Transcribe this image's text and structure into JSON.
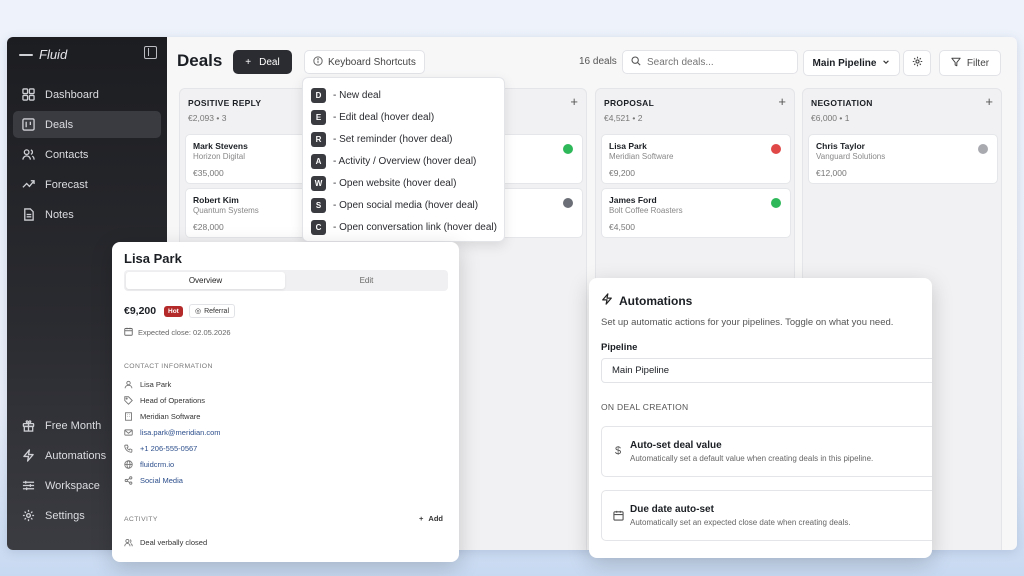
{
  "brand": {
    "name": "Fluid"
  },
  "sidebar": {
    "items": [
      {
        "label": "Dashboard",
        "icon": "grid-icon",
        "active": false
      },
      {
        "label": "Deals",
        "icon": "kanban-icon",
        "active": true
      },
      {
        "label": "Contacts",
        "icon": "users-icon",
        "active": false
      },
      {
        "label": "Forecast",
        "icon": "trend-icon",
        "active": false
      },
      {
        "label": "Notes",
        "icon": "note-icon",
        "active": false
      }
    ],
    "bottom_items": [
      {
        "label": "Free Month",
        "icon": "gift-icon"
      },
      {
        "label": "Automations",
        "icon": "bolt-icon"
      },
      {
        "label": "Workspace",
        "icon": "sliders-icon"
      },
      {
        "label": "Settings",
        "icon": "gear-icon"
      }
    ]
  },
  "header": {
    "title": "Deals",
    "new_deal_label": "Deal",
    "shortcuts_label": "Keyboard Shortcuts",
    "deal_count": "16 deals",
    "search_placeholder": "Search deals...",
    "pipeline": "Main Pipeline",
    "filter_label": "Filter"
  },
  "columns": [
    {
      "title": "POSITIVE REPLY",
      "meta": "€2,093 • 3",
      "cards": [
        {
          "name": "Mark Stevens",
          "company": "Horizon Digital",
          "value": "€35,000",
          "status_color": ""
        },
        {
          "name": "Robert Kim",
          "company": "Quantum Systems",
          "value": "€28,000",
          "status_color": ""
        }
      ]
    },
    {
      "title": "",
      "meta": "",
      "cards": [
        {
          "name": "",
          "company": "",
          "value": "",
          "status_color": "#2fb85a"
        },
        {
          "name": "",
          "company": "",
          "value": "",
          "status_color": "#6b6e76"
        }
      ]
    },
    {
      "title": "PROPOSAL",
      "meta": "€4,521 • 2",
      "cards": [
        {
          "name": "Lisa Park",
          "company": "Meridian Software",
          "value": "€9,200",
          "status_color": "#e04848"
        },
        {
          "name": "James Ford",
          "company": "Bolt Coffee Roasters",
          "value": "€4,500",
          "status_color": "#2fb85a"
        }
      ]
    },
    {
      "title": "NEGOTIATION",
      "meta": "€6,000 • 1",
      "cards": [
        {
          "name": "Chris Taylor",
          "company": "Vanguard Solutions",
          "value": "€12,000",
          "status_color": "#a8aab0"
        }
      ]
    }
  ],
  "shortcuts": [
    {
      "key": "D",
      "label": "- New deal"
    },
    {
      "key": "E",
      "label": "- Edit deal (hover deal)"
    },
    {
      "key": "R",
      "label": "- Set reminder (hover deal)"
    },
    {
      "key": "A",
      "label": "- Activity / Overview (hover deal)"
    },
    {
      "key": "W",
      "label": "- Open website (hover deal)"
    },
    {
      "key": "S",
      "label": "- Open social media (hover deal)"
    },
    {
      "key": "C",
      "label": "- Open conversation link (hover deal)"
    }
  ],
  "detail": {
    "name": "Lisa Park",
    "tabs": [
      "Overview",
      "Edit"
    ],
    "value": "€9,200",
    "hot_badge": "Hot",
    "referral_badge": "Referral",
    "expected_close": "Expected close: 02.05.2026",
    "contact_section": "CONTACT INFORMATION",
    "contact": [
      {
        "icon": "user-icon",
        "text": "Lisa Park",
        "link": false
      },
      {
        "icon": "tag-icon",
        "text": "Head of Operations",
        "link": false
      },
      {
        "icon": "building-icon",
        "text": "Meridian Software",
        "link": false
      },
      {
        "icon": "mail-icon",
        "text": "lisa.park@meridian.com",
        "link": true
      },
      {
        "icon": "phone-icon",
        "text": "+1 206-555-0567",
        "link": true
      },
      {
        "icon": "globe-icon",
        "text": "fluidcrm.io",
        "link": true
      },
      {
        "icon": "share-icon",
        "text": "Social Media",
        "link": true
      }
    ],
    "activity_section": "ACTIVITY",
    "add_label": "Add",
    "activity_item": "Deal verbally closed"
  },
  "automations": {
    "title": "Automations",
    "subtitle": "Set up automatic actions for your pipelines. Toggle on what you need.",
    "pipeline_label": "Pipeline",
    "pipeline_value": "Main Pipeline",
    "section": "ON DEAL CREATION",
    "items": [
      {
        "icon": "dollar-icon",
        "title": "Auto-set deal value",
        "desc": "Automatically set a default value when creating deals in this pipeline."
      },
      {
        "icon": "calendar-icon",
        "title": "Due date auto-set",
        "desc": "Automatically set an expected close date when creating deals."
      }
    ]
  }
}
